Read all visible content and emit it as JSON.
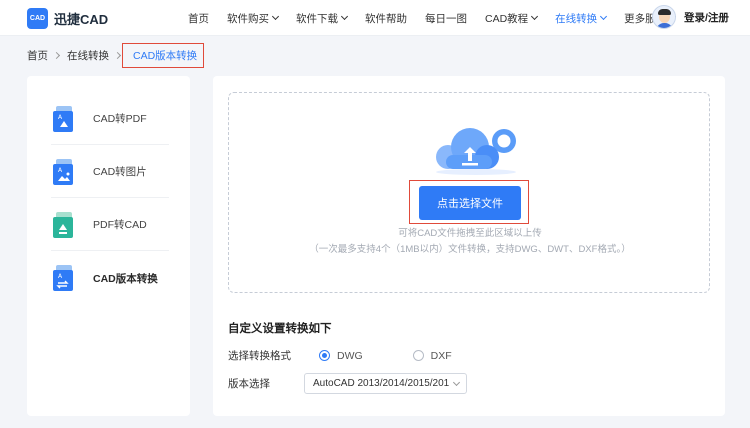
{
  "header": {
    "logo_mark": "CAD",
    "logo_text": "迅捷CAD",
    "nav": [
      {
        "label": "首页",
        "dropdown": false,
        "active": false
      },
      {
        "label": "软件购买",
        "dropdown": true,
        "active": false
      },
      {
        "label": "软件下载",
        "dropdown": true,
        "active": false
      },
      {
        "label": "软件帮助",
        "dropdown": false,
        "active": false
      },
      {
        "label": "每日一图",
        "dropdown": false,
        "active": false
      },
      {
        "label": "CAD教程",
        "dropdown": true,
        "active": false
      },
      {
        "label": "在线转换",
        "dropdown": true,
        "active": true
      },
      {
        "label": "更多服务",
        "dropdown": true,
        "active": false
      }
    ],
    "login": "登录/注册"
  },
  "breadcrumb": {
    "home": "首页",
    "section": "在线转换",
    "current": "CAD版本转换"
  },
  "sidebar": {
    "items": [
      {
        "label": "CAD转PDF",
        "icon": "cad-to-pdf-icon",
        "active": false
      },
      {
        "label": "CAD转图片",
        "icon": "cad-to-image-icon",
        "active": false
      },
      {
        "label": "PDF转CAD",
        "icon": "pdf-to-cad-icon",
        "active": false
      },
      {
        "label": "CAD版本转换",
        "icon": "cad-version-convert-icon",
        "active": true
      }
    ]
  },
  "upload": {
    "button_label": "点击选择文件",
    "hint_line1": "可将CAD文件拖拽至此区域以上传",
    "hint_line2": "（一次最多支持4个（1MB以内）文件转换，支持DWG、DWT、DXF格式。）"
  },
  "settings": {
    "title": "自定义设置转换如下",
    "format_label": "选择转换格式",
    "format_options": [
      {
        "label": "DWG",
        "selected": true
      },
      {
        "label": "DXF",
        "selected": false
      }
    ],
    "version_label": "版本选择",
    "version_value": "AutoCAD 2013/2014/2015/201"
  },
  "colors": {
    "accent": "#2f7bf6",
    "highlight_box": "#e04a3a",
    "background": "#f3f5f9"
  }
}
